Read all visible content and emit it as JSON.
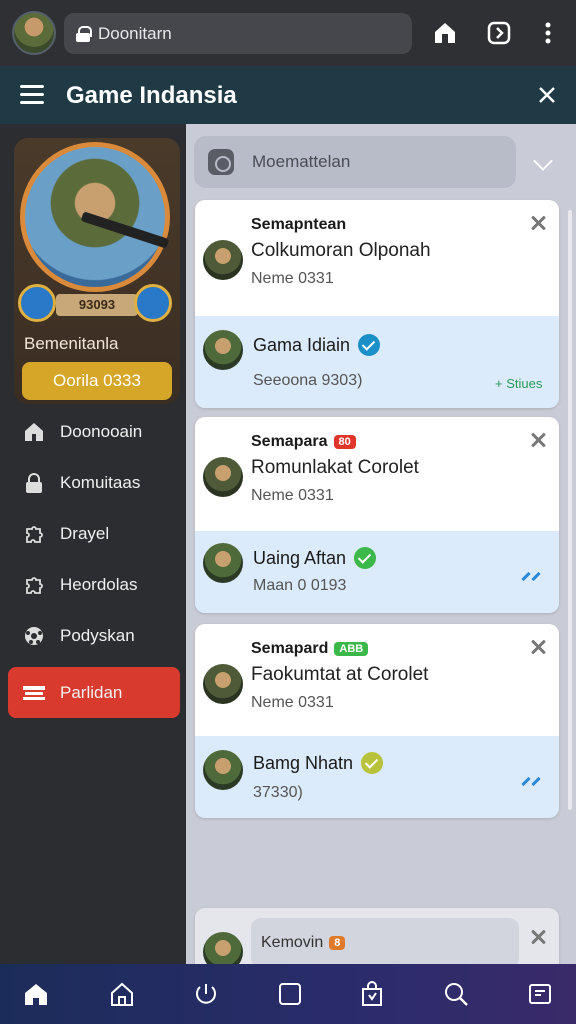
{
  "browser": {
    "url": "Doonitarn"
  },
  "header": {
    "title": "Game Indansia"
  },
  "profile": {
    "score": "93093",
    "name": "Bemenitanla",
    "badge_label": "Oorila 0333"
  },
  "nav": {
    "items": [
      {
        "label": "Doonooain",
        "icon": "home-icon"
      },
      {
        "label": "Komuitaas",
        "icon": "lock-icon"
      },
      {
        "label": "Drayel",
        "icon": "puzzle-icon"
      },
      {
        "label": "Heordolas",
        "icon": "puzzle-icon"
      },
      {
        "label": "Podyskan",
        "icon": "soccer-ball-icon"
      },
      {
        "label": "Parlidan",
        "icon": "gift-icon"
      }
    ],
    "active_index": 5
  },
  "search": {
    "placeholder": "Moemattelan"
  },
  "cards": [
    {
      "title": "Semapntean",
      "tag": "",
      "subtitle": "Colkumoran Olponah",
      "meta": "Neme 0331",
      "reply": {
        "name": "Gama Idiain",
        "meta": "Seeoona 9303)",
        "status": "Stiues",
        "check_color": "#1a8fc8"
      }
    },
    {
      "title": "Semapara",
      "tag": "80",
      "tag_color": "#e0352b",
      "subtitle": "Romunlakat Corolet",
      "meta": "Neme 0331",
      "reply": {
        "name": "Uaing Aftan",
        "meta": "Maan 0 0193",
        "status": "",
        "check_color": "#3cb84a"
      }
    },
    {
      "title": "Semapard",
      "tag": "ABB",
      "tag_color": "#3cb84a",
      "subtitle": "Faokumtat at Corolet",
      "meta": "Neme 0331",
      "reply": {
        "name": "Bamg Nhatn",
        "meta": "37330)",
        "status": "",
        "check_color": "#b8c23a"
      }
    },
    {
      "title": "Kemovin",
      "tag": "8",
      "tag_color": "#e07a2b"
    }
  ],
  "colors": {
    "header_bg": "#1f3a44",
    "active_nav": "#d93a2e",
    "badge_gold": "#d6a629"
  }
}
